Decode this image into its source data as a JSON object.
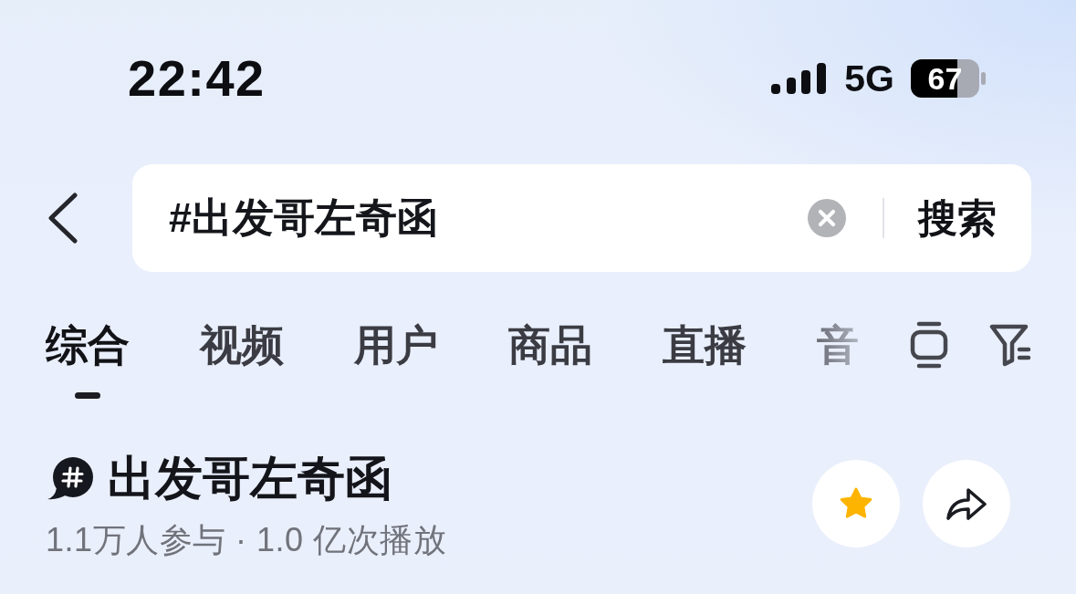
{
  "status_bar": {
    "time": "22:42",
    "network": "5G",
    "battery": "67"
  },
  "search": {
    "value": "#出发哥左奇函",
    "button": "搜索"
  },
  "tabs": [
    {
      "label": "综合",
      "selected": true
    },
    {
      "label": "视频",
      "selected": false
    },
    {
      "label": "用户",
      "selected": false
    },
    {
      "label": "商品",
      "selected": false
    },
    {
      "label": "直播",
      "selected": false
    },
    {
      "label": "音",
      "selected": false
    }
  ],
  "topic": {
    "title": "出发哥左奇函",
    "stats": "1.1万人参与 · 1.0 亿次播放",
    "favorited": true
  }
}
